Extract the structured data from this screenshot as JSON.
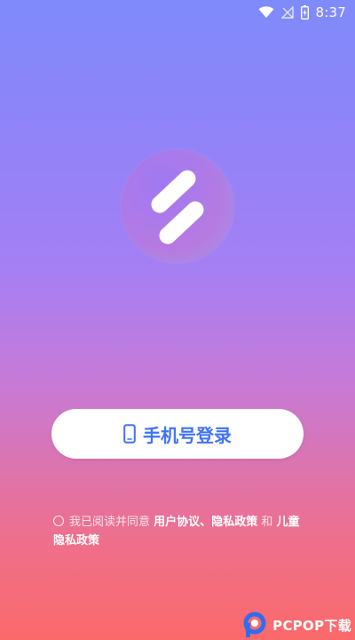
{
  "status_bar": {
    "time": "8:37",
    "icons": [
      "wifi-icon",
      "no-signal-icon",
      "battery-charging-icon"
    ]
  },
  "logo": {
    "icon": "app-logo-icon"
  },
  "login_button": {
    "label": "手机号登录",
    "icon": "phone-icon",
    "text_color": "#3f73f7"
  },
  "agreement": {
    "prefix": "我已阅读并同意",
    "user_agreement": "用户协议",
    "separator": "、",
    "privacy_policy": "隐私政策",
    "conjunction": "和",
    "children_privacy_policy": "儿童隐私政策"
  },
  "watermark": {
    "text": "PCPOP下载"
  },
  "colors": {
    "gradient_top": "#7f8bfb",
    "gradient_bottom": "#fb6a6a",
    "accent_blue": "#3f73f7"
  }
}
